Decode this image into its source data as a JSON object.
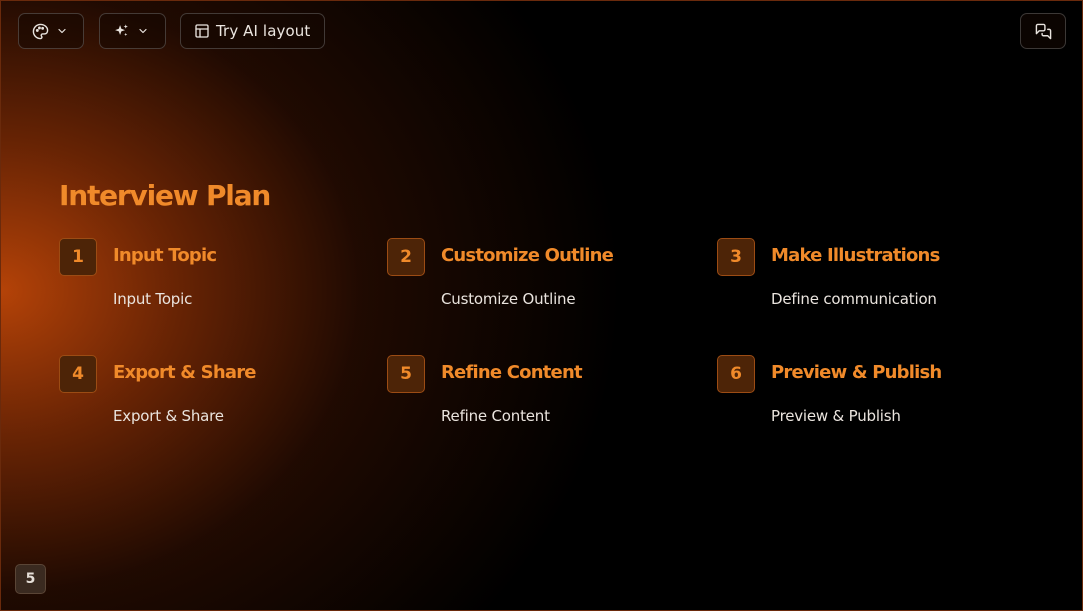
{
  "toolbar": {
    "theme_icon": "palette-icon",
    "magic_icon": "sparkles-icon",
    "layout_icon": "layout-icon",
    "layout_label": "Try AI layout",
    "comment_icon": "comments-icon",
    "chevron_icon": "chevron-down-icon"
  },
  "slide": {
    "title": "Interview Plan",
    "steps": [
      {
        "number": "1",
        "heading": "Input Topic",
        "description": "Input Topic"
      },
      {
        "number": "2",
        "heading": "Customize Outline",
        "description": "Customize Outline"
      },
      {
        "number": "3",
        "heading": "Make Illustrations",
        "description": "Define communication"
      },
      {
        "number": "4",
        "heading": "Export & Share",
        "description": "Export & Share"
      },
      {
        "number": "5",
        "heading": "Refine Content",
        "description": "Refine Content"
      },
      {
        "number": "6",
        "heading": "Preview & Publish",
        "description": "Preview & Publish"
      }
    ],
    "page_number": "5"
  },
  "colors": {
    "accent": "#f08a2a",
    "number_box_bg": "#4d2407",
    "background": "#000000",
    "glow": "#be4608"
  }
}
